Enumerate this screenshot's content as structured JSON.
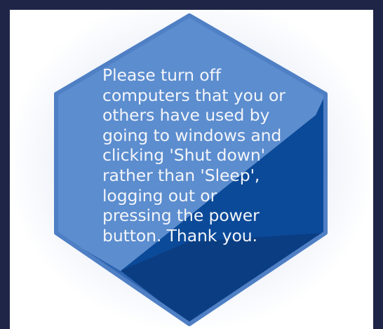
{
  "notice": {
    "message": "Please turn off\ncomputers that you or\nothers have used by\ngoing to windows and\nclicking 'Shut down'\nrather than 'Sleep',\nlogging out or\npressing the power\nbutton.  Thank you."
  },
  "colors": {
    "frame": "#1f2547",
    "panel": "#ffffff",
    "hex_light": "#5b8dcf",
    "hex_mid": "#2f66b2",
    "hex_dark": "#0b4a99",
    "text": "#f3f5f9"
  }
}
